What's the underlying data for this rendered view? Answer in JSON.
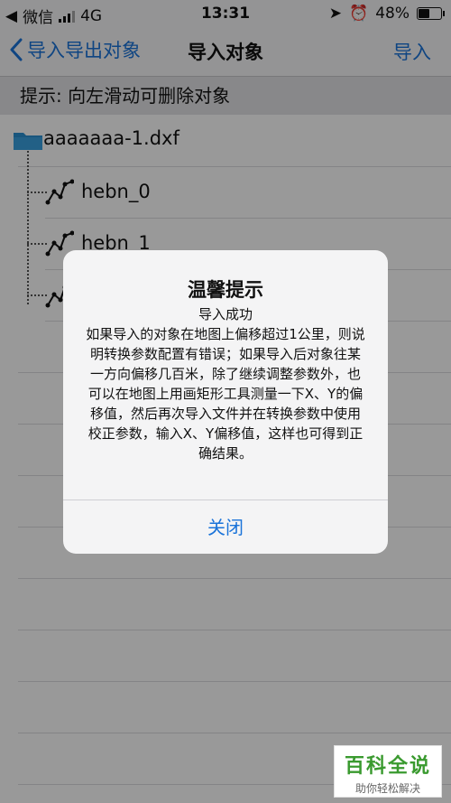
{
  "status_bar": {
    "carrier": "微信",
    "network": "4G",
    "time": "13:31",
    "battery": "48%"
  },
  "navbar": {
    "back_label": "导入导出对象",
    "title": "导入对象",
    "action": "导入"
  },
  "hint": "提示: 向左滑动可删除对象",
  "tree": {
    "file": "aaaaaaa-1.dxf",
    "children": [
      "hebn_0",
      "hebn_1",
      ""
    ]
  },
  "dialog": {
    "title": "温馨提示",
    "subtitle": "导入成功",
    "message": "如果导入的对象在地图上偏移超过1公里，则说明转换参数配置有错误；如果导入后对象往某一方向偏移几百米，除了继续调整参数外，也可以在地图上用画矩形工具测量一下X、Y的偏移值，然后再次导入文件并在转换参数中使用校正参数，输入X、Y偏移值，这样也可得到正确结果。",
    "close_label": "关闭"
  },
  "watermark": {
    "title": "百科全说",
    "subtitle": "助你轻松解决"
  },
  "colors": {
    "accent": "#1a73d9",
    "folder": "#2a8fd0"
  }
}
